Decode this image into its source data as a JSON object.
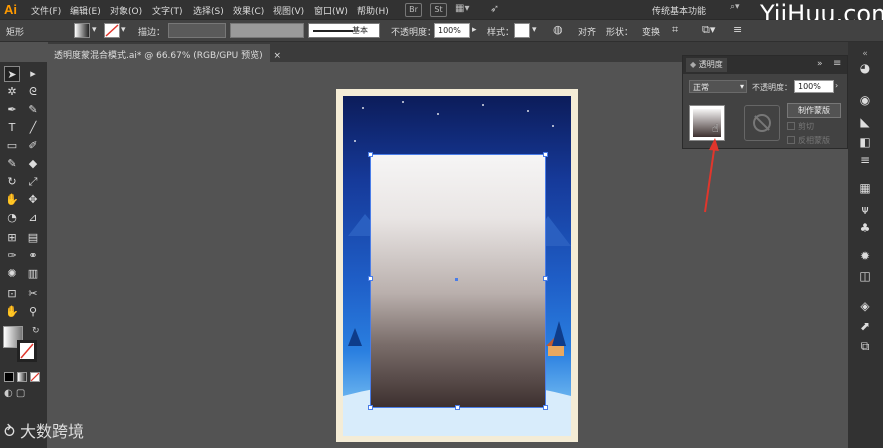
{
  "app": {
    "logo": "Ai"
  },
  "menu": [
    "文件(F)",
    "编辑(E)",
    "对象(O)",
    "文字(T)",
    "选择(S)",
    "效果(C)",
    "视图(V)",
    "窗口(W)",
    "帮助(H)"
  ],
  "menu_badges": [
    "Br",
    "St"
  ],
  "workspace": "传统基本功能",
  "watermark": "YiiHuu.com",
  "control": {
    "selection_type": "矩形",
    "stroke_label": "描边：",
    "stroke_profile": "基本",
    "opacity_label": "不透明度：",
    "opacity_value": "100%",
    "style_label": "样式：",
    "align_label": "对齐",
    "shape_label": "形状：",
    "transform_label": "变换"
  },
  "document_tab": {
    "title": "透明度蒙混合模式.ai* @ 66.67% (RGB/GPU 预览)",
    "close": "×"
  },
  "transparency_panel": {
    "title": "透明度",
    "header_controls": "»",
    "blend_mode": "正常",
    "opacity_label": "不透明度：",
    "opacity_value": "100%",
    "make_mask_button": "制作蒙版",
    "clip_label": "剪切",
    "invert_label": "反相蒙版"
  },
  "brand": {
    "text": "大数跨境"
  },
  "icons": {
    "tools": [
      "selection-tool",
      "direct-selection-tool",
      "magic-wand-tool",
      "lasso-tool",
      "pen-tool",
      "curvature-tool",
      "type-tool",
      "line-tool",
      "rectangle-tool",
      "paintbrush-tool",
      "shaper-tool",
      "eraser-tool",
      "rotate-tool",
      "scale-tool",
      "warp-tool",
      "free-transform-tool",
      "shape-builder-tool",
      "perspective-tool",
      "mesh-tool",
      "gradient-tool",
      "eyedropper-tool",
      "blend-tool",
      "symbol-sprayer-tool",
      "column-graph-tool",
      "artboard-tool",
      "slice-tool",
      "hand-tool",
      "zoom-tool"
    ],
    "dock": [
      "color-icon",
      "color-guide-icon",
      "gradient-icon",
      "transparency-icon",
      "stroke-icon",
      "swatches-icon",
      "brushes-icon",
      "symbols-icon",
      "appearance-icon",
      "graphic-styles-icon",
      "layers-icon",
      "links-icon",
      "artboards-icon"
    ]
  },
  "colors": {
    "accent": "#4a7de8",
    "arrow": "#e0362c",
    "logo": "#ff9a00"
  }
}
